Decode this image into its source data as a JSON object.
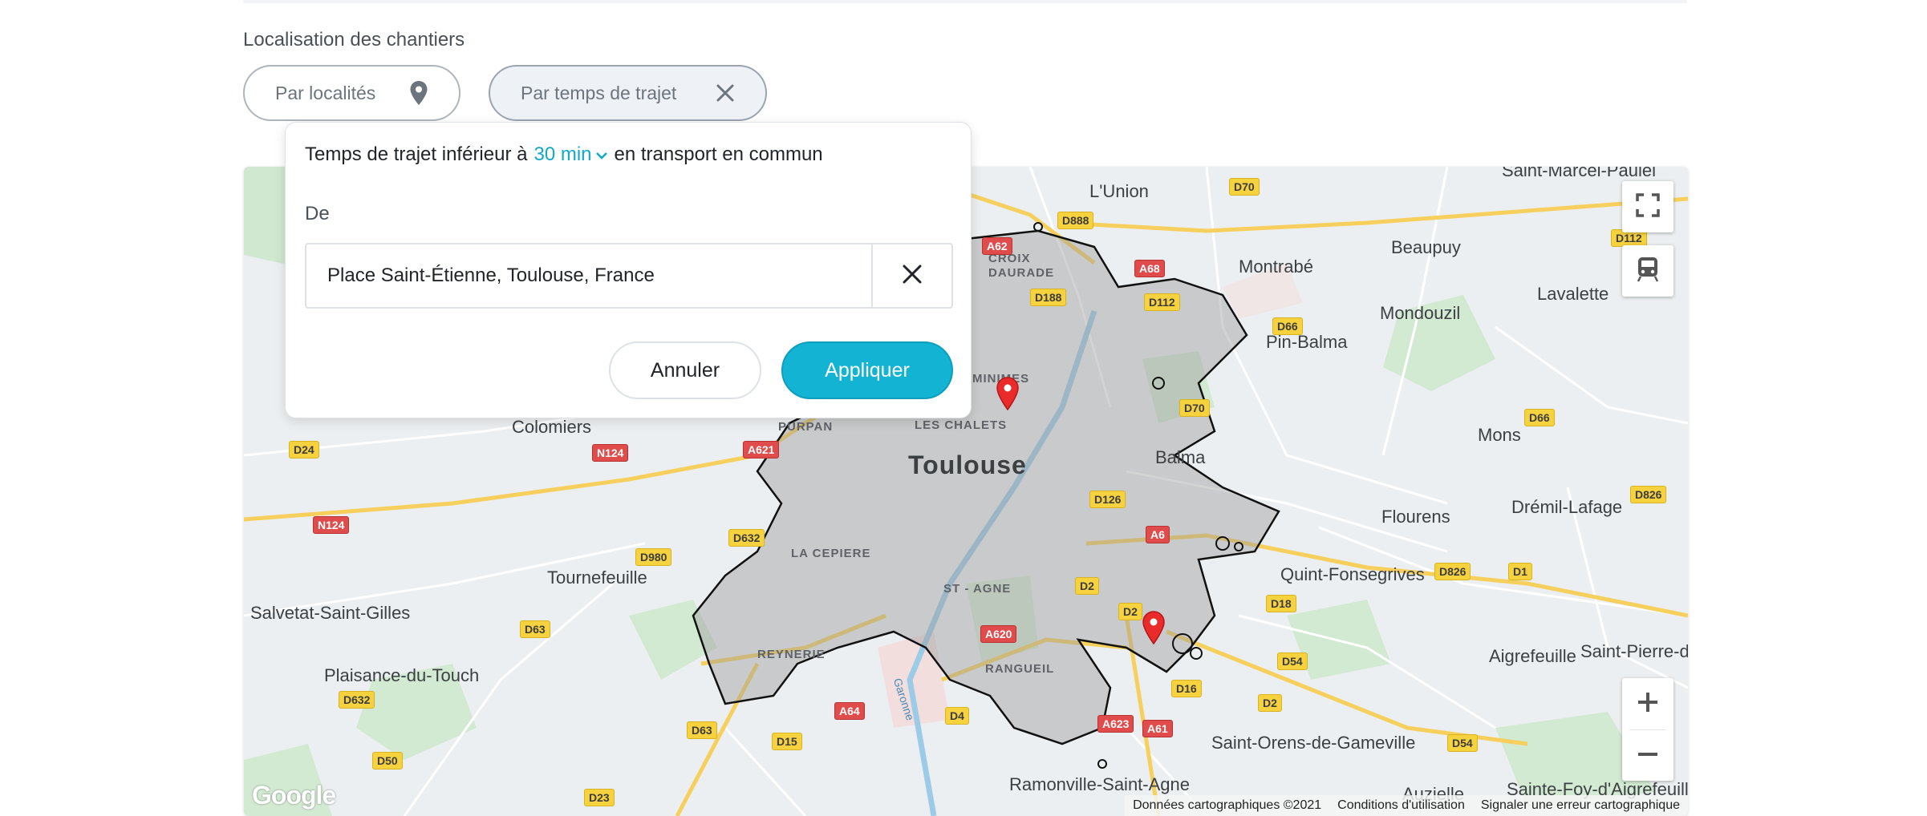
{
  "section": {
    "title": "Localisation des chantiers"
  },
  "filters": {
    "localites_label": "Par localités",
    "trajet_label": "Par temps de trajet"
  },
  "popover": {
    "prefix": "Temps de trajet inférieur à",
    "duration": "30 min",
    "suffix": "en transport en commun",
    "from_label": "De",
    "address_value": "Place Saint-Étienne, Toulouse, France",
    "cancel_label": "Annuler",
    "apply_label": "Appliquer"
  },
  "map": {
    "places": {
      "toulouse": "Toulouse",
      "colomiers": "Colomiers",
      "balma": "Balma",
      "lunion": "L'Union",
      "beaupuy": "Beaupuy",
      "montrabe": "Montrabé",
      "mondouzil": "Mondouzil",
      "lavalette": "Lavalette",
      "pinbalma": "Pin-Balma",
      "mons": "Mons",
      "flourens": "Flourens",
      "dremil": "Drémil-Lafage",
      "quint": "Quint-Fonsegrives",
      "aigrefeuille": "Aigrefeuille",
      "saintpierre": "Saint-Pierre-de",
      "tournefeuille": "Tournefeuille",
      "salvetat": "Salvetat-Saint-Gilles",
      "plaisance": "Plaisance-du-Touch",
      "saintorens": "Saint-Orens-de-Gameville",
      "ramonville": "Ramonville-Saint-Agne",
      "auzielle": "Auzielle",
      "saintefoy": "Sainte-Foy-d'Aigrefeuille",
      "saintmarcel": "Saint-Marcel-Paulel",
      "croixdaurade": "CROIX DAURADE",
      "lesChalets": "LES CHALETS",
      "purpan": "PURPAN",
      "lacepiere": "LA CEPIERE",
      "saintagne": "ST - AGNE",
      "reynerie": "REYNERIE",
      "rangueil": "RANGUEIL",
      "minimes": "MINIMES",
      "garonne": "Garonne"
    },
    "roads": {
      "d70a": "D70",
      "d888": "D888",
      "a62": "A62",
      "a68": "A68",
      "d112a": "D112",
      "d112b": "D112",
      "d66a": "D66",
      "d66b": "D66",
      "d70b": "D70",
      "d188": "D188",
      "d24": "D24",
      "n124a": "N124",
      "n124b": "N124",
      "a621": "A621",
      "d126": "D126",
      "d826a": "D826",
      "d826b": "D826",
      "d1": "D1",
      "d980": "D980",
      "d632a": "D632",
      "d632b": "D632",
      "d2a": "D2",
      "d2b": "D2",
      "a620": "A620",
      "d18": "D18",
      "d63a": "D63",
      "d63b": "D63",
      "d54a": "D54",
      "d54b": "D54",
      "d16": "D16",
      "d2c": "D2",
      "a64": "A64",
      "d4": "D4",
      "d15": "D15",
      "a623": "A623",
      "a61": "A61",
      "d50": "D50",
      "d23": "D23",
      "a6x": "A6"
    },
    "logo": "Google",
    "attribution": {
      "data": "Données cartographiques ©2021",
      "terms": "Conditions d'utilisation",
      "report": "Signaler une erreur cartographique"
    }
  },
  "icons": {
    "location": "location-pin-icon",
    "close": "close-icon",
    "chevron": "chevron-down-icon",
    "fullscreen": "fullscreen-icon",
    "transit": "transit-icon",
    "zoom_in": "zoom-in-icon",
    "zoom_out": "zoom-out-icon",
    "marker": "map-marker-icon"
  },
  "colors": {
    "accent": "#13b3d3",
    "duration_text": "#11a9c9",
    "marker": "#ea2b2b",
    "isochrone_fill": "#9e9e9e"
  }
}
